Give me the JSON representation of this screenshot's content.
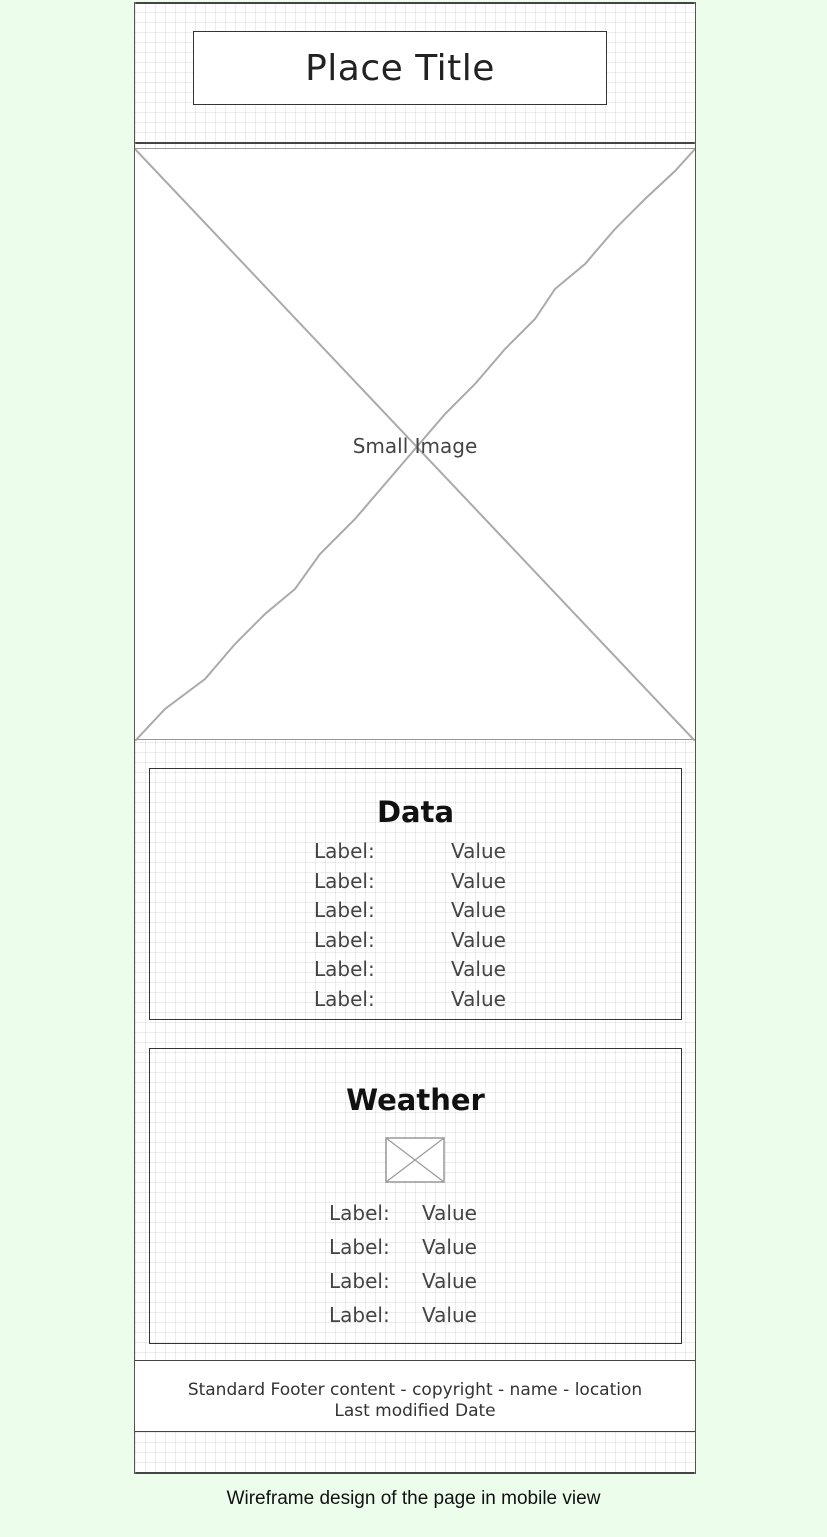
{
  "header": {
    "title": "Place Title"
  },
  "image": {
    "caption": "Small Image"
  },
  "data_section": {
    "heading": "Data",
    "rows": [
      {
        "label": "Label:",
        "value": "Value"
      },
      {
        "label": "Label:",
        "value": "Value"
      },
      {
        "label": "Label:",
        "value": "Value"
      },
      {
        "label": "Label:",
        "value": "Value"
      },
      {
        "label": "Label:",
        "value": "Value"
      },
      {
        "label": "Label:",
        "value": "Value"
      }
    ]
  },
  "weather_section": {
    "heading": "Weather",
    "icon": "image-placeholder-icon",
    "rows": [
      {
        "label": "Label:",
        "value": "Value"
      },
      {
        "label": "Label:",
        "value": "Value"
      },
      {
        "label": "Label:",
        "value": "Value"
      },
      {
        "label": "Label:",
        "value": "Value"
      }
    ]
  },
  "footer": {
    "line1": "Standard Footer content - copyright - name - location",
    "line2": "Last modified Date"
  },
  "figure_caption": "Wireframe design of the page in mobile view",
  "colors": {
    "page_background": "#ecfdeb",
    "frame_background": "#ffffff",
    "stroke": "#333333",
    "placeholder_stroke": "#aaaaaa"
  }
}
